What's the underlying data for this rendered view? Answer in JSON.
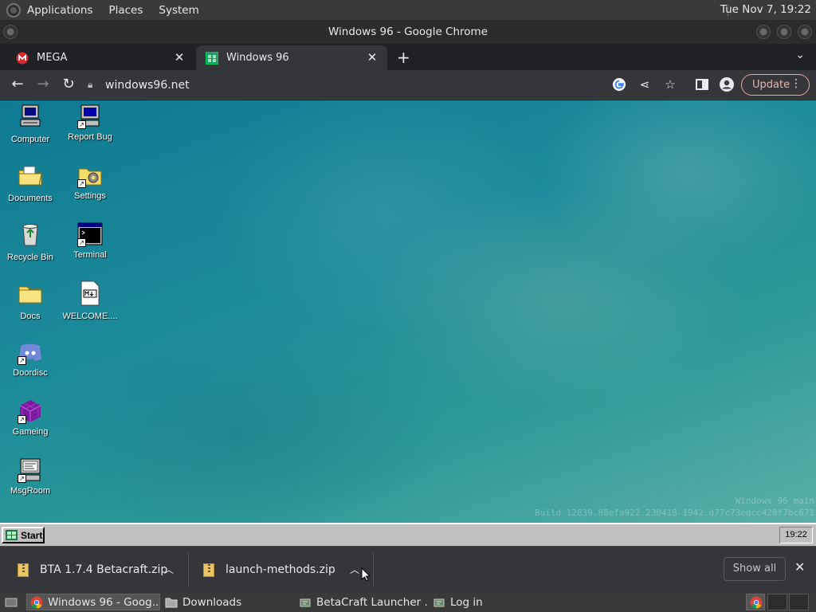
{
  "top_panel": {
    "menus": [
      "Applications",
      "Places",
      "System"
    ],
    "clock": "Tue Nov  7, 19:22"
  },
  "window": {
    "title": "Windows 96 - Google Chrome"
  },
  "tabs": [
    {
      "label": "MEGA",
      "active": false
    },
    {
      "label": "Windows 96",
      "active": true
    }
  ],
  "toolbar": {
    "url": "windows96.net",
    "update_label": "Update"
  },
  "desktop": {
    "icons": [
      {
        "label": "Computer"
      },
      {
        "label": "Report Bug"
      },
      {
        "label": "Documents"
      },
      {
        "label": "Settings"
      },
      {
        "label": "Recycle Bin"
      },
      {
        "label": "Terminal"
      },
      {
        "label": "Docs"
      },
      {
        "label": "WELCOME...."
      },
      {
        "label": "Doordisc"
      },
      {
        "label": "Gameing"
      },
      {
        "label": "MsgRoom"
      }
    ],
    "watermark_line1": "Windows 96 main",
    "watermark_line2": "Build 12839.88efa922.230418-1942.d77c73edcc428f7bc671"
  },
  "w96_taskbar": {
    "start_label": "Start",
    "clock": "19:22"
  },
  "downloads": {
    "items": [
      {
        "name": "BTA 1.7.4 Betacraft.zip"
      },
      {
        "name": "launch-methods.zip"
      }
    ],
    "show_all_label": "Show all"
  },
  "bottom_panel": {
    "tasks": [
      {
        "label": "Windows 96 - Goog...",
        "active": true
      },
      {
        "label": "Downloads",
        "active": false
      },
      {
        "label": "BetaCraft Launcher ...",
        "active": false
      },
      {
        "label": "Log in",
        "active": false
      }
    ]
  }
}
